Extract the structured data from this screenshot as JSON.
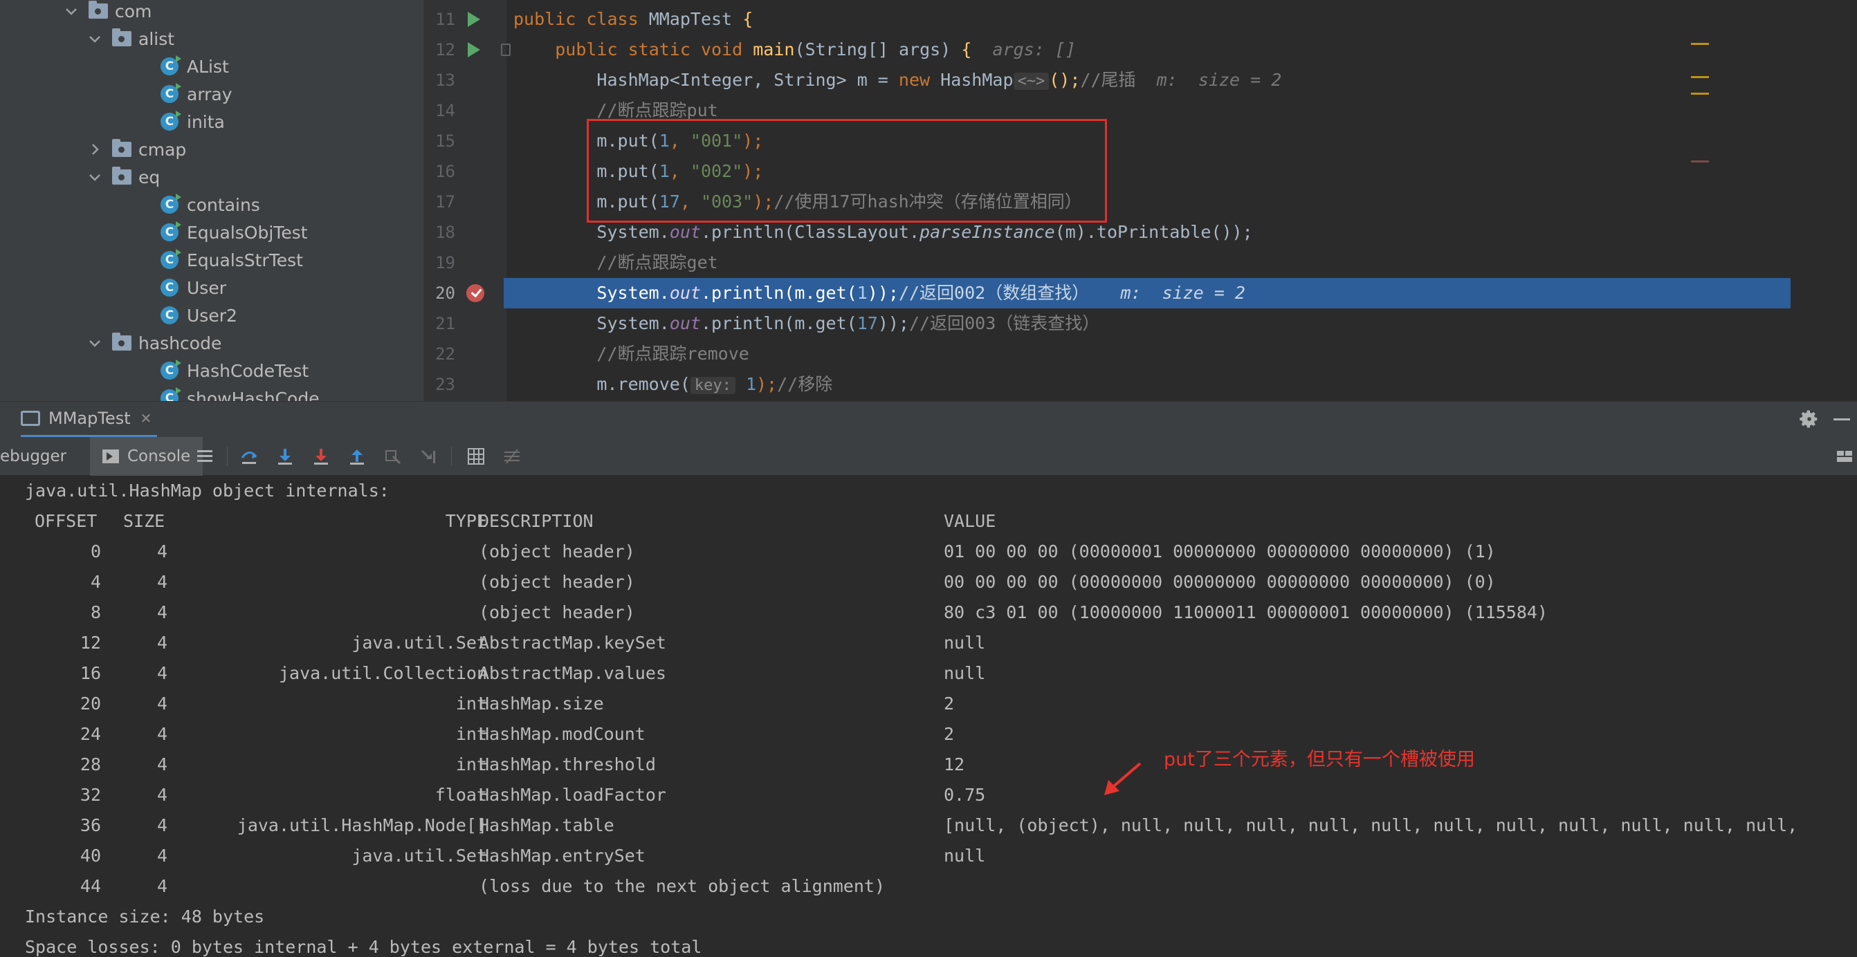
{
  "project_tree": {
    "items": [
      {
        "label": "com",
        "type": "folder",
        "expanded": true
      },
      {
        "label": "alist",
        "type": "folder",
        "expanded": true
      },
      {
        "label": "AList",
        "type": "class",
        "runnable": true
      },
      {
        "label": "array",
        "type": "class",
        "runnable": true
      },
      {
        "label": "inita",
        "type": "class",
        "runnable": true
      },
      {
        "label": "cmap",
        "type": "folder",
        "expanded": false
      },
      {
        "label": "eq",
        "type": "folder",
        "expanded": true
      },
      {
        "label": "contains",
        "type": "class",
        "runnable": true
      },
      {
        "label": "EqualsObjTest",
        "type": "class",
        "runnable": true
      },
      {
        "label": "EqualsStrTest",
        "type": "class",
        "runnable": true
      },
      {
        "label": "User",
        "type": "class",
        "runnable": false
      },
      {
        "label": "User2",
        "type": "class",
        "runnable": false
      },
      {
        "label": "hashcode",
        "type": "folder",
        "expanded": true
      },
      {
        "label": "HashCodeTest",
        "type": "class",
        "runnable": true
      },
      {
        "label": "showHashCode",
        "type": "class",
        "runnable": true
      }
    ]
  },
  "editor": {
    "line_numbers": [
      "11",
      "12",
      "13",
      "14",
      "15",
      "16",
      "17",
      "18",
      "19",
      "20",
      "21",
      "22",
      "23"
    ],
    "current_line": "20",
    "tokens": {
      "l11_public": "public",
      "l11_class": "class",
      "l11_name": "MMapTest",
      "l11_brace": "{",
      "l12_public": "public",
      "l12_static": "static",
      "l12_void": "void",
      "l12_main": "main",
      "l12_params": "(String[] args)",
      "l12_brace": "{",
      "l12_hint": "args: []",
      "l13_type": "HashMap<Integer, String> m = ",
      "l13_new": "new",
      "l13_ctor": "HashMap",
      "l13_diamond": "<~>",
      "l13_end": "();",
      "l13_comment": "//尾插",
      "l13_hint": "m:  size = 2",
      "l14_comment": "//断点跟踪put",
      "l15_pre": "m.put(",
      "l15_num": "1",
      "l15_sep": ", ",
      "l15_str": "\"001\"",
      "l15_end": ");",
      "l16_pre": "m.put(",
      "l16_num": "1",
      "l16_sep": ", ",
      "l16_str": "\"002\"",
      "l16_end": ");",
      "l17_pre": "m.put(",
      "l17_num": "17",
      "l17_sep": ", ",
      "l17_str": "\"003\"",
      "l17_end": ");",
      "l17_comment": "//使用17可hash冲突（存储位置相同）",
      "l18_pre": "System.",
      "l18_out": "out",
      "l18_mid": ".println(ClassLayout.",
      "l18_parse": "parseInstance",
      "l18_post": "(m).toPrintable());",
      "l19_comment": "//断点跟踪get",
      "l20_pre": "System.",
      "l20_out": "out",
      "l20_mid": ".println(m.get(",
      "l20_num": "1",
      "l20_end": "));",
      "l20_comment": "//返回002（数组查找）",
      "l20_hint": "m:  size = 2",
      "l21_pre": "System.",
      "l21_out": "out",
      "l21_mid": ".println(m.get(",
      "l21_num": "17",
      "l21_end": "));",
      "l21_comment": "//返回003（链表查找）",
      "l22_comment": "//断点跟踪remove",
      "l23_pre": "m.remove(",
      "l23_param": "key:",
      "l23_num": "1",
      "l23_end": ");",
      "l23_comment": "//移除"
    }
  },
  "tool_window": {
    "run_tab": "MMapTest",
    "tabs": {
      "debugger": "ebugger",
      "console": "Console"
    }
  },
  "console": {
    "header_line": "java.util.HashMap object internals:",
    "columns": {
      "offset": "OFFSET",
      "size": "SIZE",
      "type": "TYPE",
      "description": "DESCRIPTION",
      "value": "VALUE"
    },
    "rows": [
      {
        "offset": "0",
        "size": "4",
        "type": "",
        "desc": "(object header)",
        "value": "01 00 00 00 (00000001 00000000 00000000 00000000) (1)"
      },
      {
        "offset": "4",
        "size": "4",
        "type": "",
        "desc": "(object header)",
        "value": "00 00 00 00 (00000000 00000000 00000000 00000000) (0)"
      },
      {
        "offset": "8",
        "size": "4",
        "type": "",
        "desc": "(object header)",
        "value": "80 c3 01 00 (10000000 11000011 00000001 00000000) (115584)"
      },
      {
        "offset": "12",
        "size": "4",
        "type": "java.util.Set",
        "desc": "AbstractMap.keySet",
        "value": "null"
      },
      {
        "offset": "16",
        "size": "4",
        "type": "java.util.Collection",
        "desc": "AbstractMap.values",
        "value": "null"
      },
      {
        "offset": "20",
        "size": "4",
        "type": "int",
        "desc": "HashMap.size",
        "value": "2"
      },
      {
        "offset": "24",
        "size": "4",
        "type": "int",
        "desc": "HashMap.modCount",
        "value": "2"
      },
      {
        "offset": "28",
        "size": "4",
        "type": "int",
        "desc": "HashMap.threshold",
        "value": "12"
      },
      {
        "offset": "32",
        "size": "4",
        "type": "float",
        "desc": "HashMap.loadFactor",
        "value": "0.75"
      },
      {
        "offset": "36",
        "size": "4",
        "type": "java.util.HashMap.Node[]",
        "desc": "HashMap.table",
        "value": "[null, (object), null, null, null, null, null, null, null, null, null, null, null,"
      },
      {
        "offset": "40",
        "size": "4",
        "type": "java.util.Set",
        "desc": "HashMap.entrySet",
        "value": "null"
      },
      {
        "offset": "44",
        "size": "4",
        "type": "",
        "desc": "(loss due to the next object alignment)",
        "value": ""
      }
    ],
    "instance_size": "Instance size: 48 bytes",
    "space_losses": "Space losses: 0 bytes internal + 4 bytes external = 4 bytes total"
  },
  "annotation": "put了三个元素，但只有一个槽被使用",
  "colors": {
    "highlight": "#2d5e99",
    "annotation_red": "#e8342d",
    "keyword": "#cc7832",
    "string": "#6a8759",
    "number": "#6897bb"
  }
}
